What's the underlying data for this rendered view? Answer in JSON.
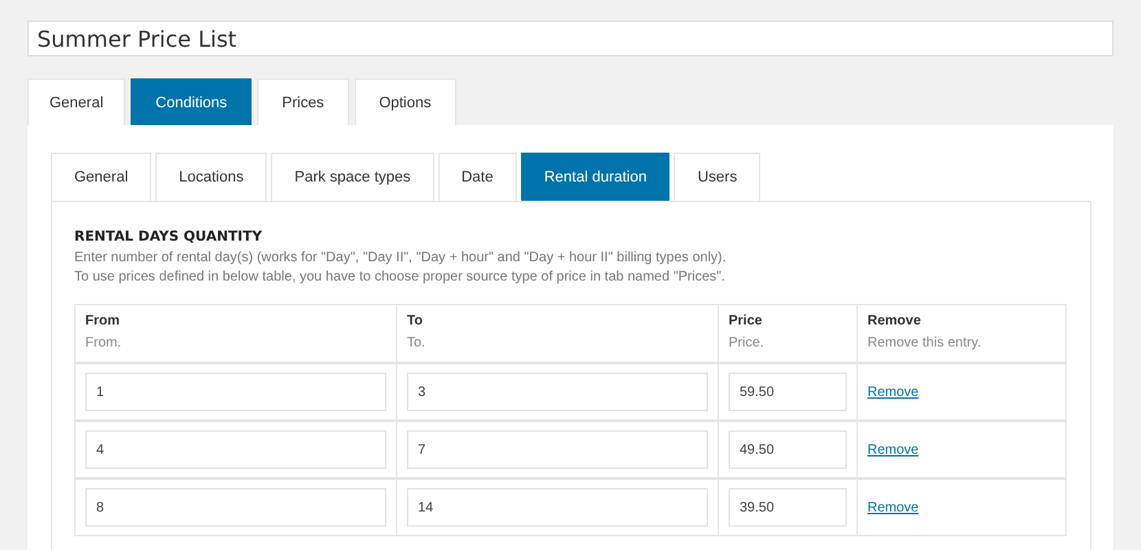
{
  "title_field": {
    "value": "Summer Price List"
  },
  "tabs": [
    {
      "label": "General",
      "selected": false
    },
    {
      "label": "Conditions",
      "selected": true
    },
    {
      "label": "Prices",
      "selected": false
    },
    {
      "label": "Options",
      "selected": false
    }
  ],
  "subtabs": [
    {
      "label": "General",
      "selected": false
    },
    {
      "label": "Locations",
      "selected": false
    },
    {
      "label": "Park space types",
      "selected": false
    },
    {
      "label": "Date",
      "selected": false
    },
    {
      "label": "Rental duration",
      "selected": true
    },
    {
      "label": "Users",
      "selected": false
    }
  ],
  "section": {
    "heading": "RENTAL DAYS QUANTITY",
    "description": [
      "Enter number of rental day(s) (works for \"Day\", \"Day II\", \"Day + hour\" and \"Day + hour II\" billing types only).",
      "To use prices defined in below table, you have to choose proper source type of price in tab named \"Prices\"."
    ]
  },
  "table": {
    "columns": [
      {
        "title": "From",
        "hint": "From."
      },
      {
        "title": "To",
        "hint": "To."
      },
      {
        "title": "Price",
        "hint": "Price."
      },
      {
        "title": "Remove",
        "hint": "Remove this entry."
      }
    ],
    "rows": [
      {
        "from": "1",
        "to": "3",
        "price": "59.50",
        "action": "Remove"
      },
      {
        "from": "4",
        "to": "7",
        "price": "49.50",
        "action": "Remove"
      },
      {
        "from": "8",
        "to": "14",
        "price": "39.50",
        "action": "Remove"
      }
    ]
  }
}
